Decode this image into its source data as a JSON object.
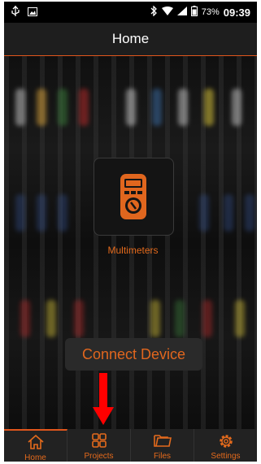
{
  "status_bar": {
    "battery_percent": "73%",
    "time": "09:39",
    "icons": [
      "usb-icon",
      "image-icon",
      "bluetooth-icon",
      "wifi-icon",
      "signal-icon",
      "battery-icon"
    ]
  },
  "app_bar": {
    "title": "Home"
  },
  "device": {
    "label": "Multimeters",
    "icon": "multimeter-icon"
  },
  "connect_button": {
    "label": "Connect Device"
  },
  "bottom_nav": {
    "items": [
      {
        "label": "Home",
        "icon": "home-icon",
        "active": true
      },
      {
        "label": "Projects",
        "icon": "grid-icon",
        "active": false
      },
      {
        "label": "Files",
        "icon": "folder-icon",
        "active": false
      },
      {
        "label": "Settings",
        "icon": "gear-icon",
        "active": false
      }
    ]
  },
  "colors": {
    "accent": "#e0561c",
    "background": "#0c0c0c",
    "annotation_arrow": "#ff0000"
  }
}
